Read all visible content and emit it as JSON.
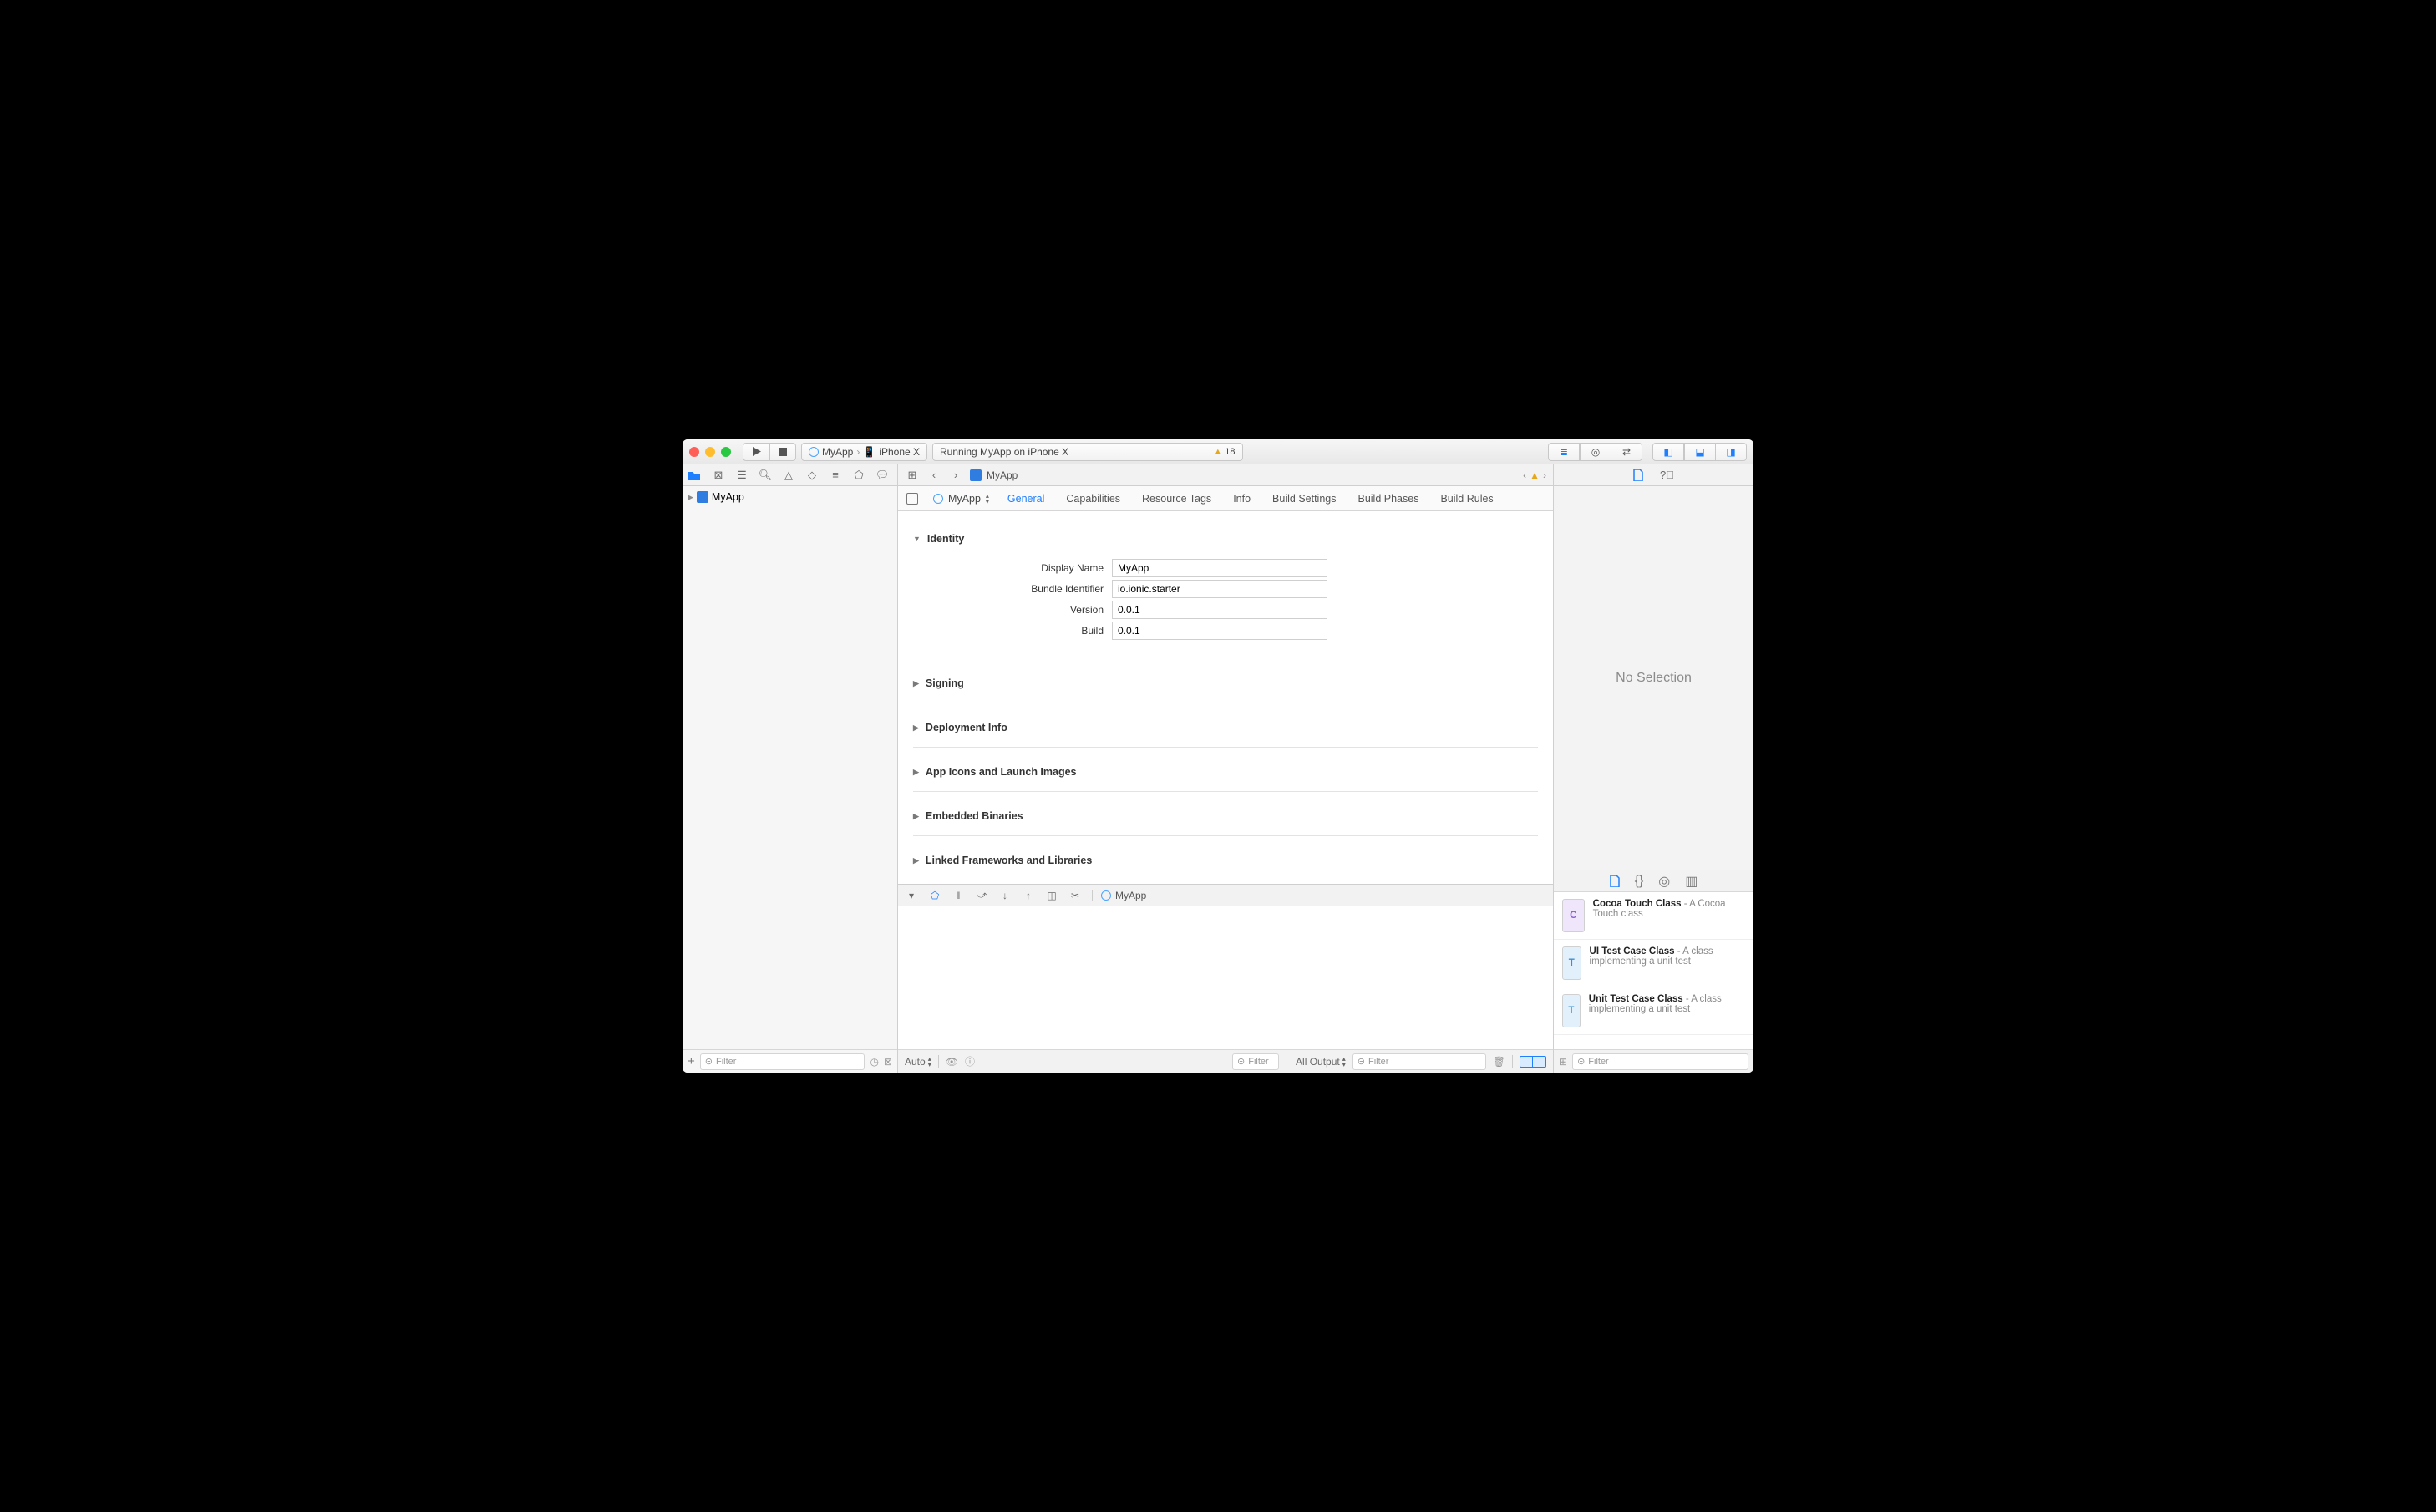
{
  "scheme": {
    "target": "MyApp",
    "device": "iPhone X"
  },
  "activity": {
    "status": "Running MyApp on iPhone X",
    "warning_count": "18"
  },
  "navigator": {
    "root": "MyApp"
  },
  "jumpbar": {
    "project": "MyApp"
  },
  "target_selector": {
    "name": "MyApp"
  },
  "tabs": {
    "general": "General",
    "capabilities": "Capabilities",
    "resource_tags": "Resource Tags",
    "info": "Info",
    "build_settings": "Build Settings",
    "build_phases": "Build Phases",
    "build_rules": "Build Rules"
  },
  "sections": {
    "identity": "Identity",
    "signing": "Signing",
    "deployment": "Deployment Info",
    "icons": "App Icons and Launch Images",
    "embedded": "Embedded Binaries",
    "linked": "Linked Frameworks and Libraries"
  },
  "identity": {
    "display_name_label": "Display Name",
    "display_name": "MyApp",
    "bundle_id_label": "Bundle Identifier",
    "bundle_id": "io.ionic.starter",
    "version_label": "Version",
    "version": "0.0.1",
    "build_label": "Build",
    "build": "0.0.1"
  },
  "debug": {
    "process": "MyApp",
    "vars_scope": "Auto",
    "vars_filter_placeholder": "Filter",
    "output_mode": "All Output",
    "console_filter_placeholder": "Filter"
  },
  "inspector": {
    "empty": "No Selection"
  },
  "library": {
    "items": [
      {
        "icon": "C",
        "title": "Cocoa Touch Class",
        "desc": "A Cocoa Touch class"
      },
      {
        "icon": "T",
        "title": "UI Test Case Class",
        "desc": "A class implementing a unit test"
      },
      {
        "icon": "T",
        "title": "Unit Test Case Class",
        "desc": "A class implementing a unit test"
      }
    ],
    "filter_placeholder": "Filter"
  },
  "filter": {
    "sidebar_placeholder": "Filter"
  }
}
